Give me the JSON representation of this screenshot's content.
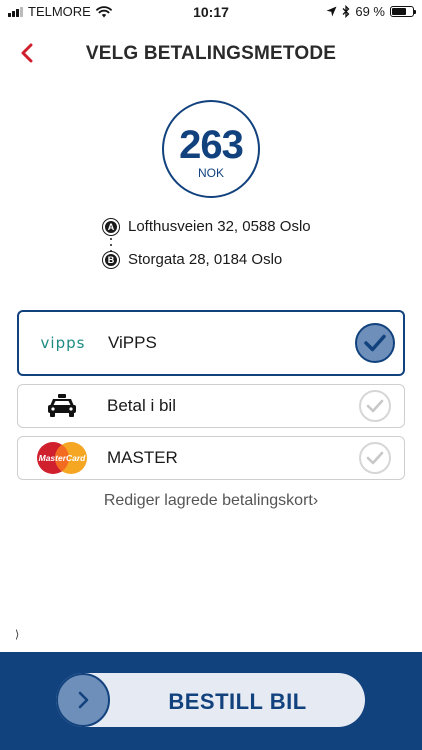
{
  "status_bar": {
    "carrier": "TELMORE",
    "time": "10:17",
    "battery_percent": "69 %",
    "battery_level": 0.69,
    "icons": [
      "signal-icon",
      "wifi-icon",
      "location-arrow-icon",
      "bluetooth-icon",
      "battery-icon"
    ]
  },
  "header": {
    "title": "VELG BETALINGSMETODE",
    "back_icon": "chevron-left-icon"
  },
  "price": {
    "amount": "263",
    "currency": "NOK"
  },
  "route": {
    "from_marker": "A",
    "from_address": "Lofthusveien 32, 0588 Oslo",
    "to_marker": "B",
    "to_address": "Storgata 28, 0184 Oslo"
  },
  "payment_options": [
    {
      "logo": "vipps-logo",
      "logo_text": "vipps",
      "label": "ViPPS",
      "selected": true
    },
    {
      "logo": "taxi-icon",
      "label": "Betal i bil",
      "selected": false
    },
    {
      "logo": "mastercard-logo",
      "logo_text": "MasterCard",
      "label": "MASTER",
      "selected": false
    }
  ],
  "edit_cards_link": "Rediger lagrede betalingskort",
  "edit_cards_chevron": "›",
  "stray_chevron": "⟩",
  "order_button": {
    "label": "BESTILL BIL",
    "knob_icon": "chevron-right-icon"
  },
  "colors": {
    "brand_blue": "#12427e",
    "accent_red": "#d0202e",
    "vipps_teal": "#1c8b82",
    "knob_fill": "#6d8fba"
  }
}
